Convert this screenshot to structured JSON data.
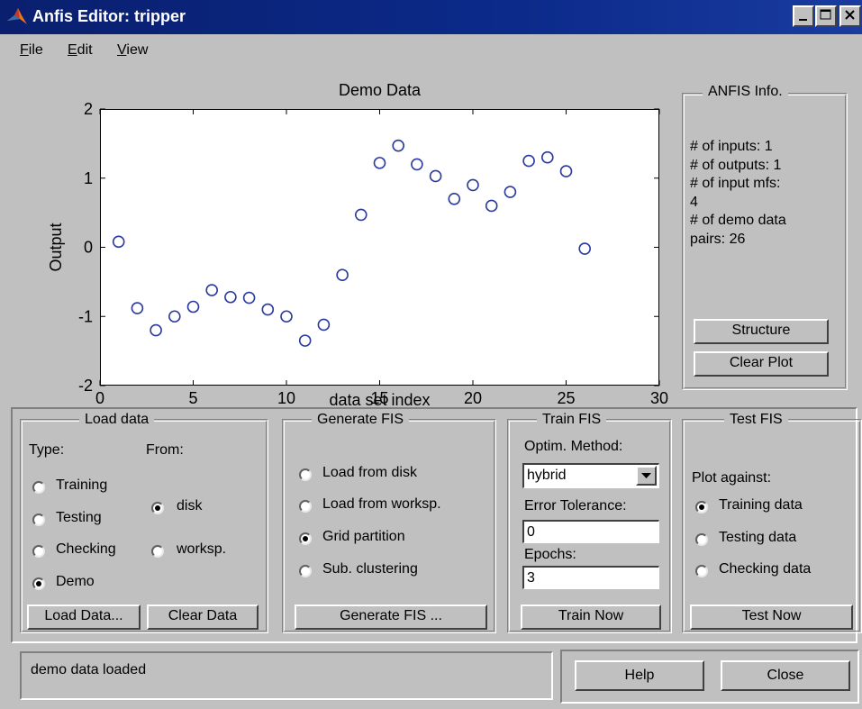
{
  "window": {
    "title": "Anfis Editor: tripper"
  },
  "menu": [
    {
      "label": "File",
      "accel": "F",
      "rest": "ile"
    },
    {
      "label": "Edit",
      "accel": "E",
      "rest": "dit"
    },
    {
      "label": "View",
      "accel": "V",
      "rest": "iew"
    }
  ],
  "chart_data": {
    "type": "scatter",
    "title": "Demo Data",
    "xlabel": "data set index",
    "ylabel": "Output",
    "xlim": [
      0,
      30
    ],
    "ylim": [
      -2,
      2
    ],
    "xticks": [
      "0",
      "5",
      "10",
      "15",
      "20",
      "25",
      "30"
    ],
    "yticks": [
      "2",
      "1",
      "0",
      "-1",
      "-2"
    ],
    "marker": "circle-open",
    "marker_color": "#2b3a9e",
    "x": [
      1,
      2,
      3,
      4,
      5,
      6,
      7,
      8,
      9,
      10,
      11,
      12,
      13,
      14,
      15,
      16,
      17,
      18,
      19,
      20,
      21,
      22,
      23,
      24,
      25,
      26
    ],
    "y": [
      0.08,
      -0.88,
      -1.2,
      -1.0,
      -0.86,
      -0.62,
      -0.72,
      -0.73,
      -0.9,
      -1.0,
      -1.35,
      -1.12,
      -0.4,
      0.47,
      1.22,
      1.47,
      1.2,
      1.03,
      0.7,
      0.9,
      0.6,
      0.8,
      1.25,
      1.3,
      1.1,
      -0.02
    ]
  },
  "anfis_info": {
    "title": "ANFIS Info.",
    "lines": [
      "# of inputs: 1",
      "# of outputs: 1",
      "# of input mfs:",
      "4",
      "# of demo data",
      "pairs: 26"
    ],
    "structure_button": "Structure",
    "clear_plot_button": "Clear Plot"
  },
  "load_data": {
    "title": "Load data",
    "type_label": "Type:",
    "from_label": "From:",
    "types": [
      {
        "label": "Training",
        "checked": false
      },
      {
        "label": "Testing",
        "checked": false
      },
      {
        "label": "Checking",
        "checked": false
      },
      {
        "label": "Demo",
        "checked": true
      }
    ],
    "sources": [
      {
        "label": "disk",
        "checked": true
      },
      {
        "label": "worksp.",
        "checked": false
      }
    ],
    "load_button": "Load Data...",
    "clear_button": "Clear Data"
  },
  "generate_fis": {
    "title": "Generate FIS",
    "options": [
      {
        "label": "Load from disk",
        "checked": false
      },
      {
        "label": "Load from worksp.",
        "checked": false
      },
      {
        "label": "Grid partition",
        "checked": true
      },
      {
        "label": "Sub. clustering",
        "checked": false
      }
    ],
    "button": "Generate FIS ..."
  },
  "train_fis": {
    "title": "Train FIS",
    "method_label": "Optim. Method:",
    "method_value": "hybrid",
    "error_label": "Error Tolerance:",
    "error_value": "0",
    "epochs_label": "Epochs:",
    "epochs_value": "3",
    "button": "Train Now"
  },
  "test_fis": {
    "title": "Test FIS",
    "plot_label": "Plot against:",
    "options": [
      {
        "label": "Training data",
        "checked": true
      },
      {
        "label": "Testing data",
        "checked": false
      },
      {
        "label": "Checking data",
        "checked": false
      }
    ],
    "button": "Test Now"
  },
  "status": {
    "text": "demo data loaded"
  },
  "footer": {
    "help_button": "Help",
    "close_button": "Close"
  }
}
